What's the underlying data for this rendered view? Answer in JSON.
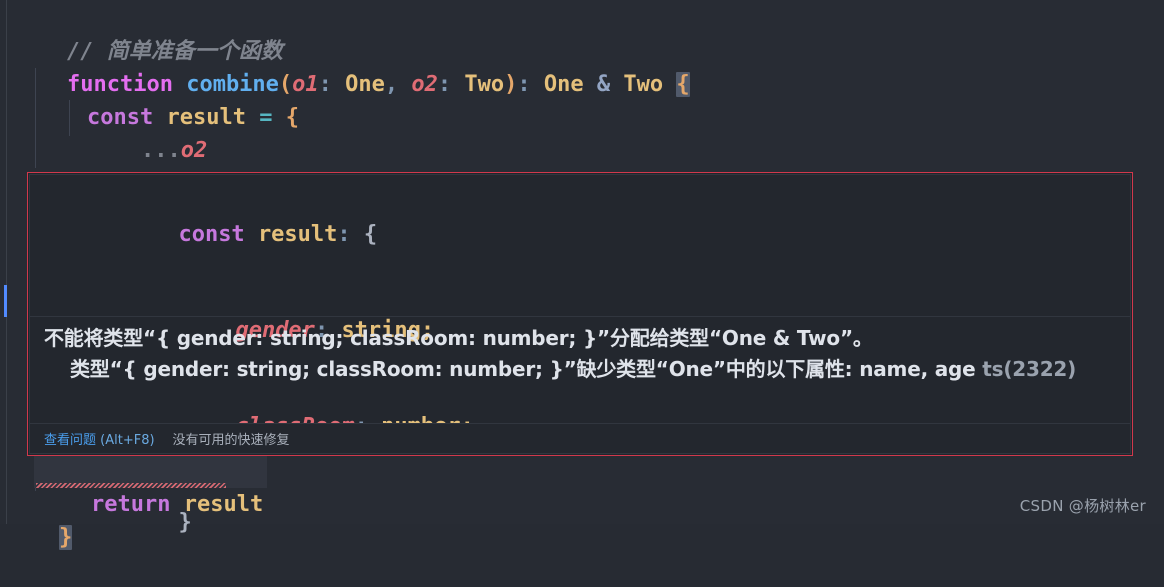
{
  "editor": {
    "theme_background": "#282c34",
    "lines": [
      {
        "id": "line-comment",
        "text": "// 简单准备一个函数"
      },
      {
        "id": "line-function-signature",
        "tokens": {
          "keyword": "function",
          "name": "combine",
          "open_paren": "(",
          "param1": "o1",
          "colon1": ": ",
          "type1": "One",
          "comma": ", ",
          "param2": "o2",
          "colon2": ": ",
          "type2": "Two",
          "close_paren": ")",
          "colon3": ": ",
          "return_type_a": "One",
          "amp": " & ",
          "return_type_b": "Two",
          "open_brace": "{"
        }
      },
      {
        "id": "line-const-result",
        "tokens": {
          "keyword": "const",
          "name": "result",
          "equals": "=",
          "open_brace": "{"
        }
      },
      {
        "id": "line-spread",
        "tokens": {
          "dots": "...",
          "name": "o2"
        }
      },
      {
        "id": "line-close-obj",
        "text": "}"
      },
      {
        "id": "line-return",
        "tokens": {
          "keyword": "return",
          "name": "result"
        }
      },
      {
        "id": "line-close-func",
        "text": "}"
      }
    ]
  },
  "popup": {
    "code_preview": {
      "line1": {
        "keyword": "const",
        "name": "result",
        "colon": ": ",
        "brace": "{"
      },
      "line2": {
        "prop": "gender",
        "colon": ": ",
        "type": "string",
        "semi": ";"
      },
      "line3": {
        "prop": "classRoom",
        "colon": ": ",
        "type": "number",
        "semi": ";"
      },
      "line4": "}"
    },
    "message": "不能将类型“{ gender: string; classRoom: number; }”分配给类型“One & Two”。\n    类型“{ gender: string; classRoom: number; }”缺少类型“One”中的以下属性: name, age ",
    "message_line1": "不能将类型“{ gender: string; classRoom: number; }”分配给类型“One & Two”。",
    "message_line2": "类型“{ gender: string; classRoom: number; }”缺少类型“One”中的以下属性: name, age",
    "error_code": "ts(2322)",
    "actions": {
      "view_problem": "查看问题",
      "view_problem_shortcut": "(Alt+F8)",
      "no_quick_fix": "没有可用的快速修复"
    },
    "border_color": "#d1384c"
  },
  "watermark": "CSDN @杨树林er"
}
